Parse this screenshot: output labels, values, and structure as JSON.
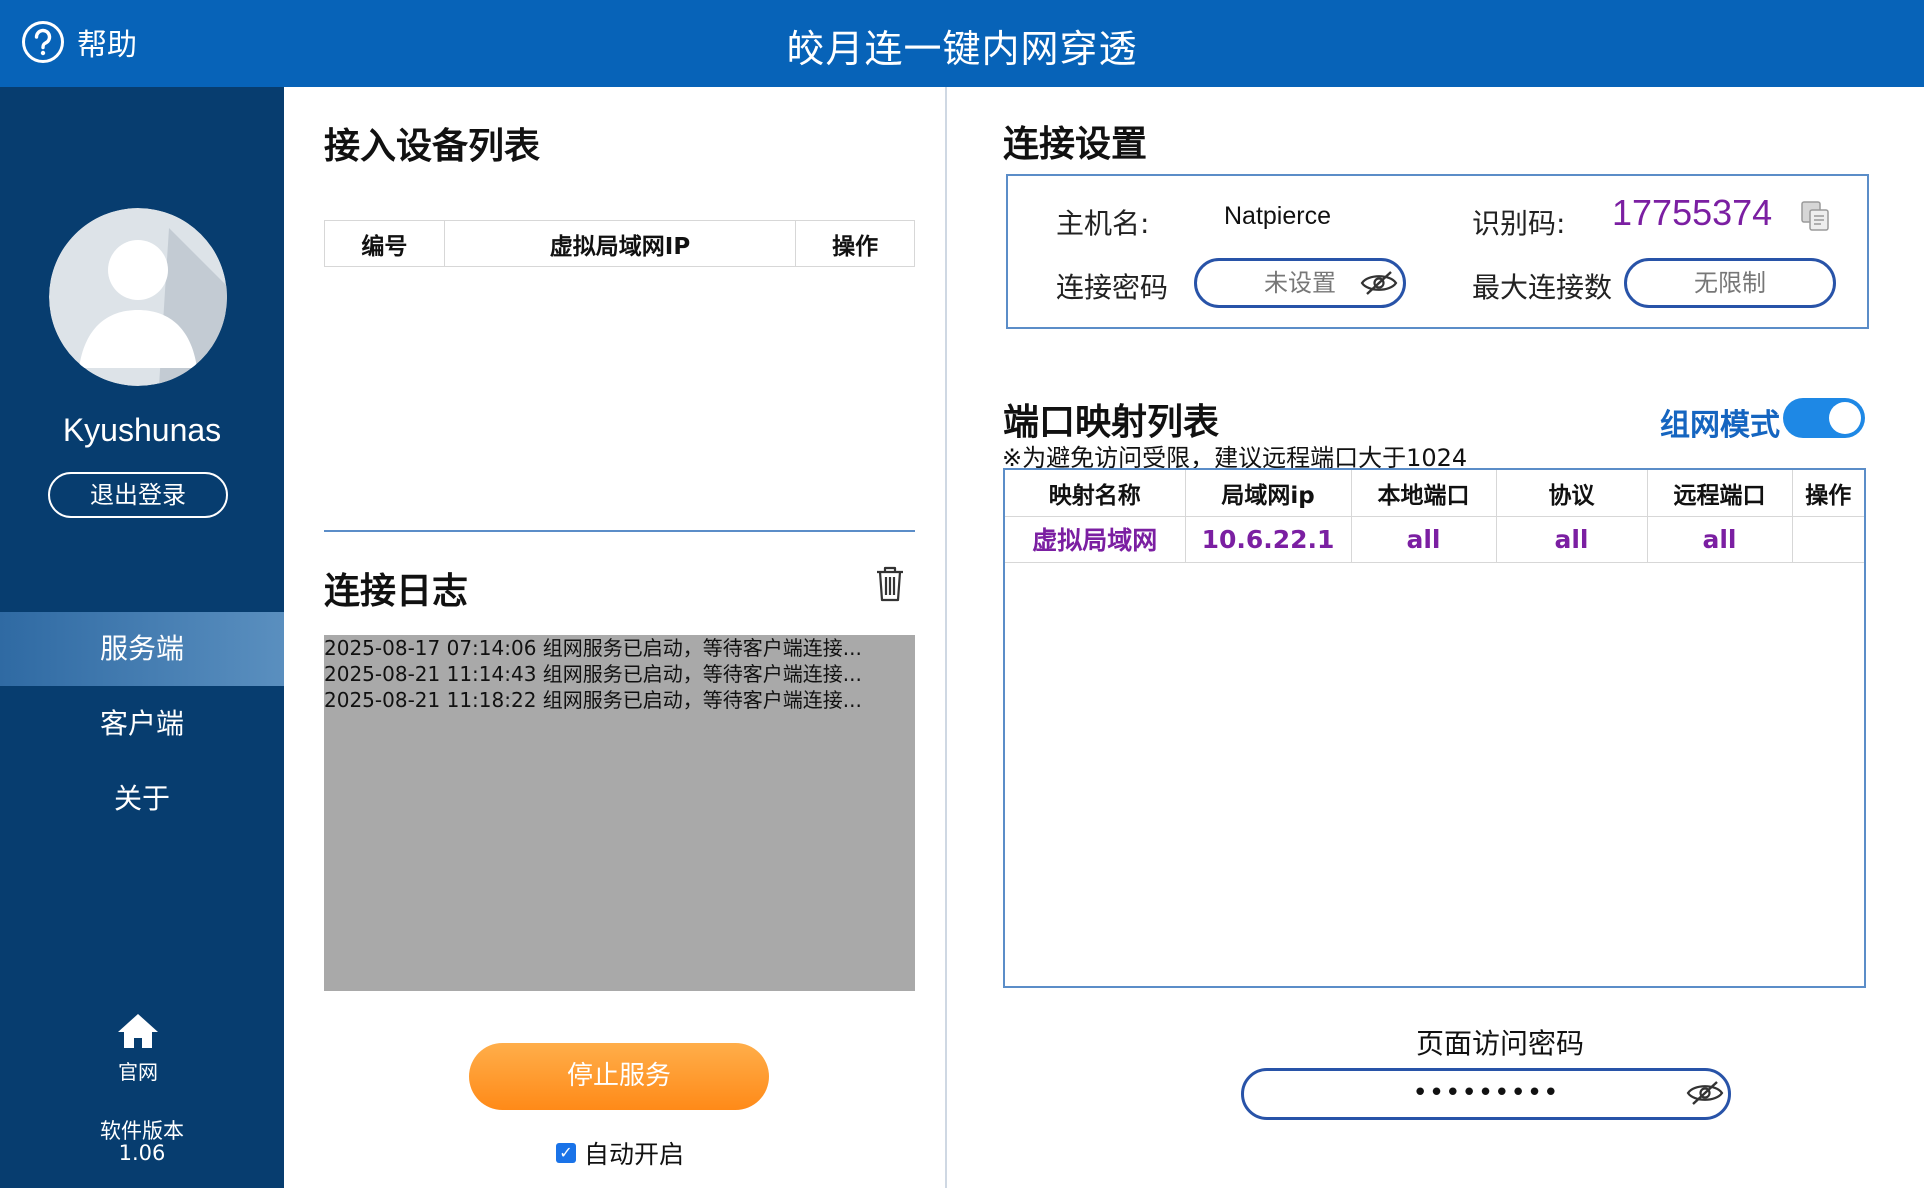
{
  "header": {
    "help_label": "帮助",
    "app_title": "皎月连一键内网穿透"
  },
  "sidebar": {
    "username": "Kyushunas",
    "logout_label": "退出登录",
    "nav": [
      {
        "label": "服务端"
      },
      {
        "label": "客户端"
      },
      {
        "label": "关于"
      }
    ],
    "home_label": "官网",
    "version_label": "软件版本",
    "version": "1.06"
  },
  "devices": {
    "title": "接入设备列表",
    "columns": [
      "编号",
      "虚拟局域网IP",
      "操作"
    ]
  },
  "log": {
    "title": "连接日志",
    "lines": [
      "2025-08-17 07:14:06 组网服务已启动，等待客户端连接...",
      "2025-08-21 11:14:43 组网服务已启动，等待客户端连接...",
      "2025-08-21 11:18:22 组网服务已启动，等待客户端连接..."
    ]
  },
  "actions": {
    "stop_label": "停止服务",
    "auto_start_label": "自动开启",
    "auto_start_checked": true
  },
  "connection": {
    "title": "连接设置",
    "host_label": "主机名:",
    "host_value": "Natpierce",
    "code_label": "识别码:",
    "code_value": "17755374",
    "password_label": "连接密码",
    "password_value": "未设置",
    "max_label": "最大连接数",
    "max_value": "无限制"
  },
  "ports": {
    "title": "端口映射列表",
    "hint": "※为避免访问受限，建议远程端口大于1024",
    "mesh_label": "组网模式",
    "mesh_enabled": true,
    "columns": [
      "映射名称",
      "局域网ip",
      "本地端口",
      "协议",
      "远程端口",
      "操作"
    ],
    "rows": [
      [
        "虚拟局域网",
        "10.6.22.1",
        "all",
        "all",
        "all",
        ""
      ]
    ]
  },
  "page_password": {
    "label": "页面访问密码",
    "value": "•••••••••"
  },
  "colors": {
    "header": "#0763b8",
    "sidebar": "#073d6f",
    "accent_purple": "#7b1fa2",
    "button_orange": "#ff8a18",
    "border_blue": "#2853a8"
  }
}
